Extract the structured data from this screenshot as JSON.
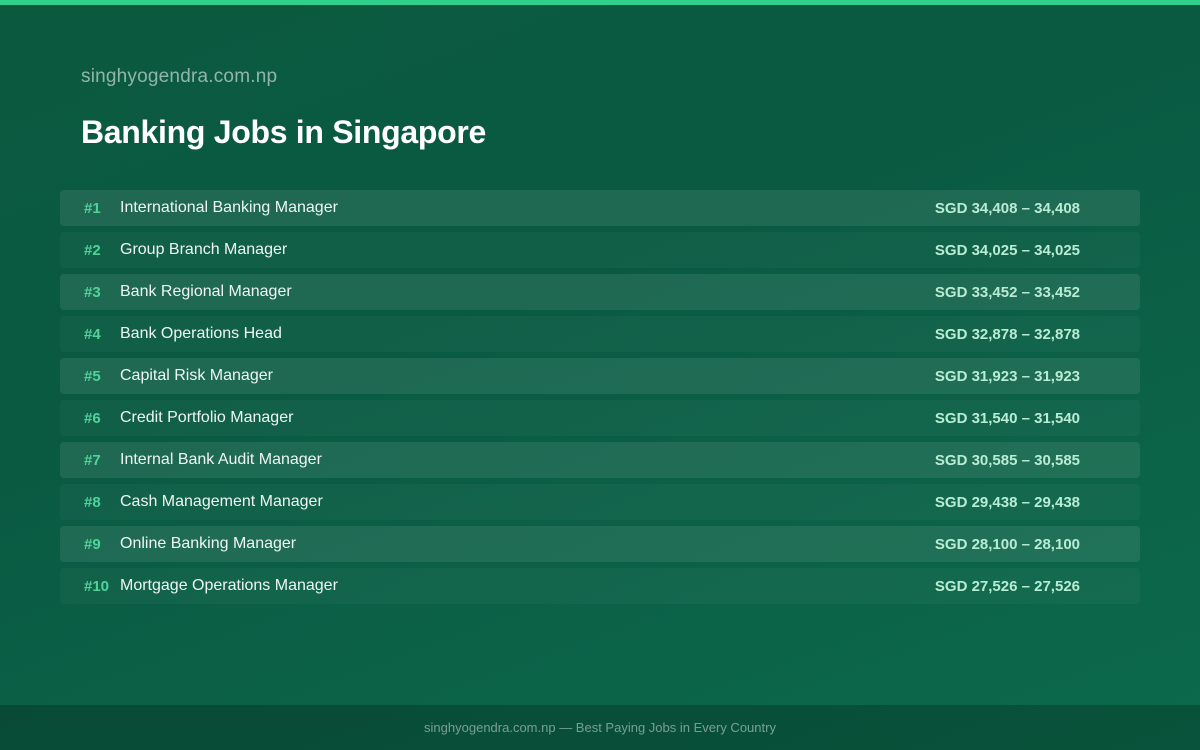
{
  "header": {
    "site_name": "singhyogendra.com.np",
    "title": "Banking Jobs in Singapore"
  },
  "jobs": [
    {
      "rank": "#1",
      "title": "International Banking Manager",
      "salary": "SGD 34,408 – 34,408"
    },
    {
      "rank": "#2",
      "title": "Group Branch Manager",
      "salary": "SGD 34,025 – 34,025"
    },
    {
      "rank": "#3",
      "title": "Bank Regional Manager",
      "salary": "SGD 33,452 – 33,452"
    },
    {
      "rank": "#4",
      "title": "Bank Operations Head",
      "salary": "SGD 32,878 – 32,878"
    },
    {
      "rank": "#5",
      "title": "Capital Risk Manager",
      "salary": "SGD 31,923 – 31,923"
    },
    {
      "rank": "#6",
      "title": "Credit Portfolio Manager",
      "salary": "SGD 31,540 – 31,540"
    },
    {
      "rank": "#7",
      "title": "Internal Bank Audit Manager",
      "salary": "SGD 30,585 – 30,585"
    },
    {
      "rank": "#8",
      "title": "Cash Management Manager",
      "salary": "SGD 29,438 – 29,438"
    },
    {
      "rank": "#9",
      "title": "Online Banking Manager",
      "salary": "SGD 28,100 – 28,100"
    },
    {
      "rank": "#10",
      "title": "Mortgage Operations Manager",
      "salary": "SGD 27,526 – 27,526"
    }
  ],
  "footer": {
    "text": "singhyogendra.com.np — Best Paying Jobs in Every Country"
  },
  "colors": {
    "accent": "#2fd08c",
    "rank": "#4ed39a",
    "background": "#0b5a40"
  }
}
